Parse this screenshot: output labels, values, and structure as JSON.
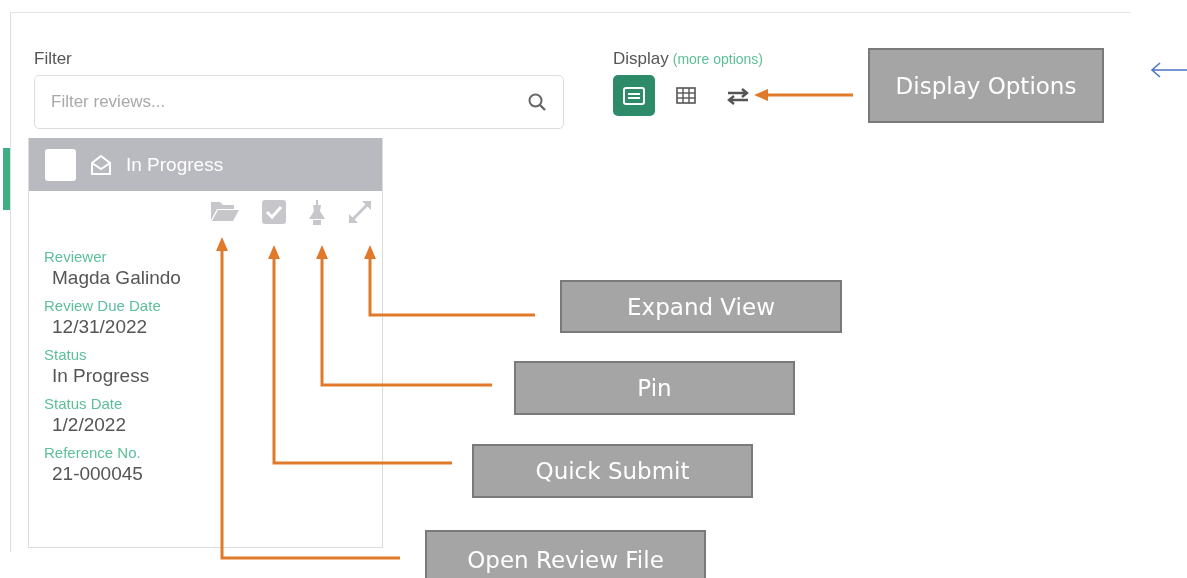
{
  "filter": {
    "label": "Filter",
    "placeholder": "Filter reviews..."
  },
  "card": {
    "checked": false,
    "title": "In Progress",
    "fields": [
      {
        "label": "Reviewer",
        "value": "Magda Galindo"
      },
      {
        "label": "Review Due Date",
        "value": "12/31/2022"
      },
      {
        "label": "Status",
        "value": "In Progress"
      },
      {
        "label": "Status Date",
        "value": "1/2/2022"
      },
      {
        "label": "Reference No.",
        "value": "21-000045"
      }
    ]
  },
  "display": {
    "label": "Display",
    "link": "(more options)",
    "modes": [
      {
        "kind": "cards",
        "selected": true
      },
      {
        "kind": "table",
        "selected": false
      },
      {
        "kind": "swap",
        "selected": false
      }
    ]
  },
  "callouts": [
    {
      "text": "Display Options"
    },
    {
      "text": "Expand View"
    },
    {
      "text": "Pin"
    },
    {
      "text": "Quick Submit"
    },
    {
      "text": "Open Review File"
    }
  ]
}
